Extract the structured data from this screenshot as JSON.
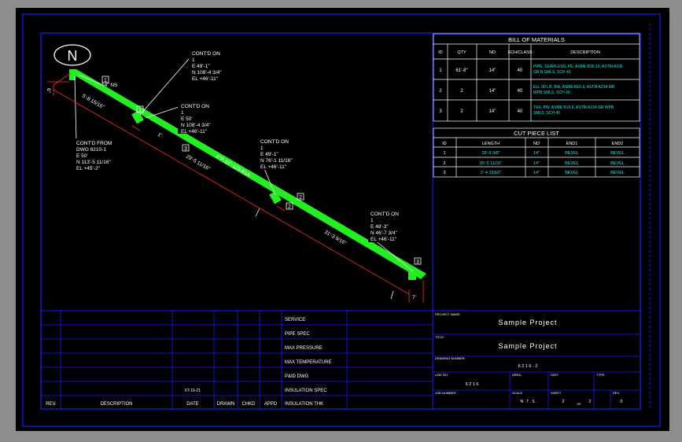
{
  "north_label": "N",
  "iso_labels": {
    "top_size": "14\" NS",
    "pipe_tag": "6\"P-10\"-123-B1A",
    "cont_on_1": [
      "CONT'D ON",
      "1",
      "E 49'-1\"",
      "N 108'-4 3/4\"",
      "EL +46'-11\""
    ],
    "cont_on_2": [
      "CONT'D ON",
      "1",
      "E 50'",
      "N 108'-4 3/4\"",
      "EL +46'-11\""
    ],
    "cont_on_3": [
      "CONT'D ON",
      "1",
      "E 49'-1\"",
      "N 76'-1 11/16\"",
      "EL +46'-11\""
    ],
    "cont_on_4": [
      "CONT'D ON",
      "1",
      "E 48'-3\"",
      "N 46'-7 3/4\"",
      "EL +46'-11\""
    ],
    "cont_from": [
      "CONT'D FROM",
      "DWG 6210-1",
      "E 50'",
      "N 113'-5 11/16\"",
      "EL +45'-2\""
    ],
    "dims": [
      "5'-8 15/16\"",
      "29'-5 11/16\"",
      "31'-3 9/16\"",
      "6\"",
      "1'",
      "7'"
    ],
    "markers": [
      "1",
      "1",
      "3",
      "2",
      "3",
      "2"
    ]
  },
  "bom": {
    "title": "BILL OF MATERIALS",
    "headers": [
      "ID",
      "QTY",
      "ND",
      "SCH/CLASS",
      "DESCRIPTION"
    ],
    "rows": [
      {
        "id": "1",
        "qty": "61'-8\"",
        "nd": "14\"",
        "sch": "40",
        "desc": [
          "PIPE, SEAMLESS, PE, ASME B36.10, ASTM A106",
          "GR B SMLS, SCH 40"
        ]
      },
      {
        "id": "2",
        "qty": "2",
        "nd": "14\"",
        "sch": "40",
        "desc": [
          "ELL 90 LR, BW, ASME B16.9, ASTM A234 GR",
          "WPB SMLS, SCH 40"
        ]
      },
      {
        "id": "3",
        "qty": "2",
        "nd": "14\"",
        "sch": "40",
        "desc": [
          "TEE, BW, ASME B16.9, ASTM A234 GR WPB",
          "SMLS, SCH 40"
        ]
      }
    ]
  },
  "cut": {
    "title": "CUT PIECE LIST",
    "headers": [
      "ID",
      "LENGTH",
      "ND",
      "END1",
      "END2"
    ],
    "rows": [
      {
        "id": "1",
        "length": "28'-9 3/8\"",
        "nd": "14\"",
        "end1": "BEVEL",
        "end2": "BEVEL"
      },
      {
        "id": "2",
        "length": "30'-5 11/16\"",
        "nd": "14\"",
        "end1": "BEVEL",
        "end2": "BEVEL"
      },
      {
        "id": "3",
        "length": "2'-4 15/16\"",
        "nd": "14\"",
        "end1": "BEVEL",
        "end2": "BEVEL"
      }
    ]
  },
  "rev": {
    "headers": [
      "REV.",
      "DESCRIPTION",
      "DATE",
      "DRAWN",
      "CHKD",
      "APPD"
    ],
    "entry": "6T-16-21"
  },
  "spec": [
    "SERVICE",
    "PIPE SPEC",
    "MAX PRESSURE",
    "MAX TEMPERATURE",
    "P&ID DWG",
    "INSULATION SPEC",
    "INSULATION THK"
  ],
  "title_block": {
    "project_label": "PROJECT NAME:",
    "project_value": "Sample Project",
    "title_label": "TITLE:",
    "title_value": "Sample Project",
    "drawing_label": "DRAWING NUMBER:",
    "drawing_value": "6 2 1 6 - 2",
    "line_label": "LINE NO.",
    "line_value": "6 2 1 6",
    "area_label": "AREA:",
    "unit_label": "UNIT:",
    "type_label": "TYPE:",
    "job_label": "JOB NUMBER:",
    "scale_label": "SCALE",
    "scale_value": "N . T . S .",
    "sheet_label": "SHEET",
    "sheet_value": "2",
    "of_label": "OF",
    "of_value": "2",
    "rev_label": "REV.",
    "rev_value": "0"
  }
}
